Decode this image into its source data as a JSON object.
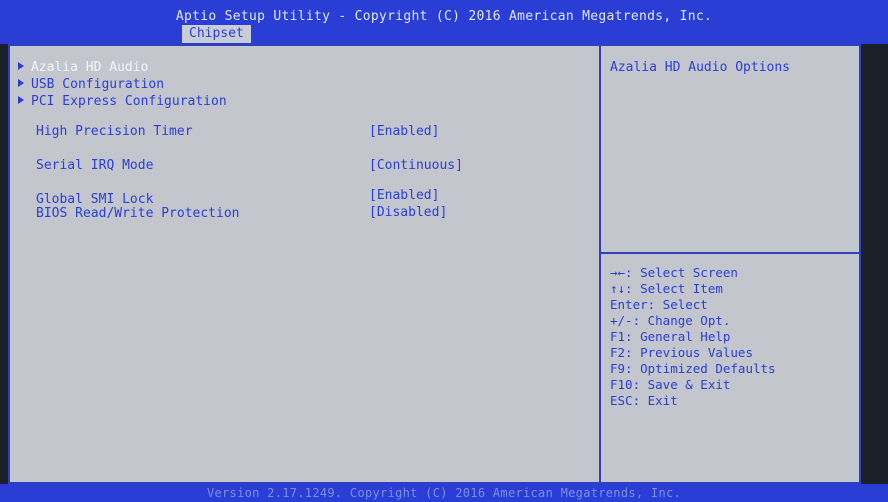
{
  "header": {
    "title": "Aptio Setup Utility - Copyright (C) 2016 American Megatrends, Inc.",
    "active_tab": "Chipset"
  },
  "menu": {
    "submenus": [
      {
        "label": "Azalia HD Audio",
        "selected": true
      },
      {
        "label": "USB Configuration",
        "selected": false
      },
      {
        "label": "PCI Express Configuration",
        "selected": false
      }
    ],
    "settings": [
      {
        "label": "High Precision Timer",
        "value": "[Enabled]"
      },
      {
        "label": "Serial IRQ Mode",
        "value": "[Continuous]"
      },
      {
        "label": "Global SMI Lock",
        "value": "[Enabled]"
      },
      {
        "label": "BIOS Read/Write Protection",
        "value": "[Disabled]"
      }
    ]
  },
  "help": {
    "description": "Azalia HD Audio Options",
    "keys": [
      "→←: Select Screen",
      "↑↓: Select Item",
      "Enter: Select",
      "+/-: Change Opt.",
      "F1: General Help",
      "F2: Previous Values",
      "F9: Optimized Defaults",
      "F10: Save & Exit",
      "ESC: Exit"
    ]
  },
  "footer": {
    "text": "Version 2.17.1249. Copyright (C) 2016 American Megatrends, Inc."
  },
  "colors": {
    "accent_blue": "#2a3ed6",
    "panel_grey": "#c3c6cd",
    "selected_text": "#f2f4ff"
  },
  "icons": {
    "submenu_marker": "triangle-right-icon"
  }
}
